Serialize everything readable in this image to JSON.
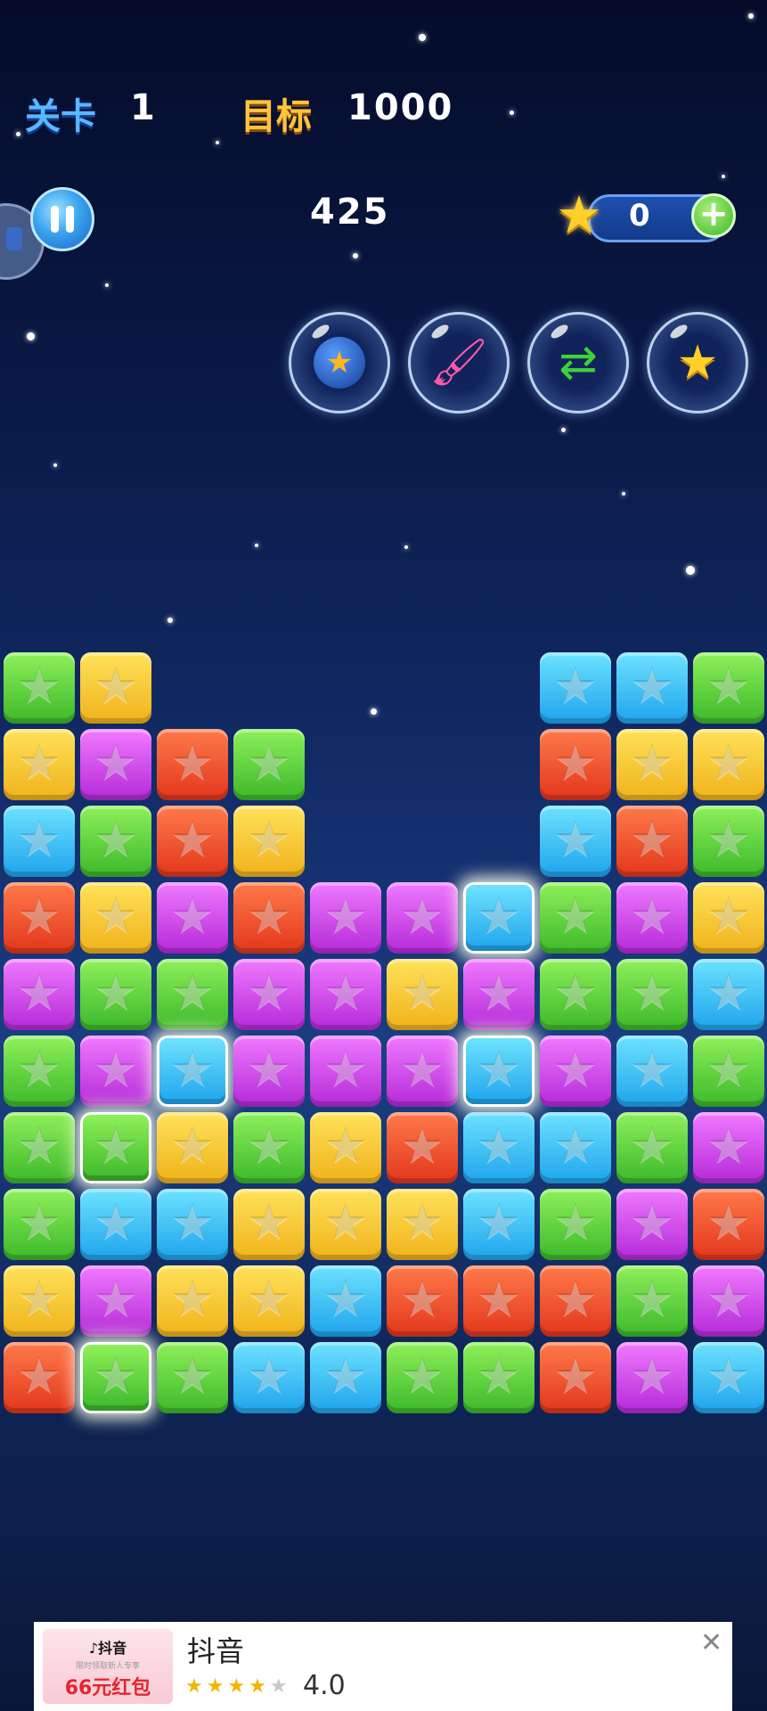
{
  "hud": {
    "level_label": "关卡",
    "level_value": "1",
    "target_label": "目标",
    "target_value": "1000",
    "score": "425",
    "coins": "0",
    "add_symbol": "+"
  },
  "powerups": [
    {
      "name": "bomb",
      "icon": "bomb-icon"
    },
    {
      "name": "rainbow-brush",
      "icon": "brush-icon"
    },
    {
      "name": "swap",
      "icon": "swap-icon"
    },
    {
      "name": "video-star",
      "icon": "video-star-icon"
    }
  ],
  "board": {
    "rows": [
      [
        "green",
        "yellow",
        "",
        "",
        "",
        "",
        "",
        "blue",
        "blue",
        "green"
      ],
      [
        "yellow",
        "purple",
        "red",
        "green",
        "",
        "",
        "",
        "red",
        "yellow",
        "yellow"
      ],
      [
        "blue",
        "green",
        "red",
        "yellow",
        "",
        "",
        "",
        "blue",
        "red",
        "green"
      ],
      [
        "red",
        "yellow",
        "purple",
        "red",
        "purple",
        "purple",
        "blue",
        "green",
        "purple",
        "yellow"
      ],
      [
        "purple",
        "green",
        "green",
        "purple",
        "purple",
        "yellow",
        "purple",
        "green",
        "green",
        "blue"
      ],
      [
        "green",
        "purple",
        "blue",
        "purple",
        "purple",
        "purple",
        "blue",
        "purple",
        "blue",
        "green"
      ],
      [
        "green",
        "green",
        "yellow",
        "green",
        "yellow",
        "red",
        "blue",
        "blue",
        "green",
        "purple"
      ],
      [
        "green",
        "blue",
        "blue",
        "yellow",
        "yellow",
        "yellow",
        "blue",
        "green",
        "purple",
        "red"
      ],
      [
        "yellow",
        "purple",
        "yellow",
        "yellow",
        "blue",
        "red",
        "red",
        "red",
        "green",
        "purple"
      ],
      [
        "red",
        "green",
        "green",
        "blue",
        "blue",
        "green",
        "green",
        "red",
        "purple",
        "blue"
      ]
    ],
    "highlighted": [
      [
        3,
        6
      ],
      [
        5,
        2
      ],
      [
        5,
        6
      ],
      [
        6,
        1
      ],
      [
        9,
        1
      ]
    ]
  },
  "ad": {
    "brand": "♪抖音",
    "thumb_note": "限时领取新人专享",
    "promo": "66元红包",
    "title": "抖音",
    "stars": "★★★★",
    "star_empty": "★",
    "rating": "4.0",
    "close": "✕"
  }
}
